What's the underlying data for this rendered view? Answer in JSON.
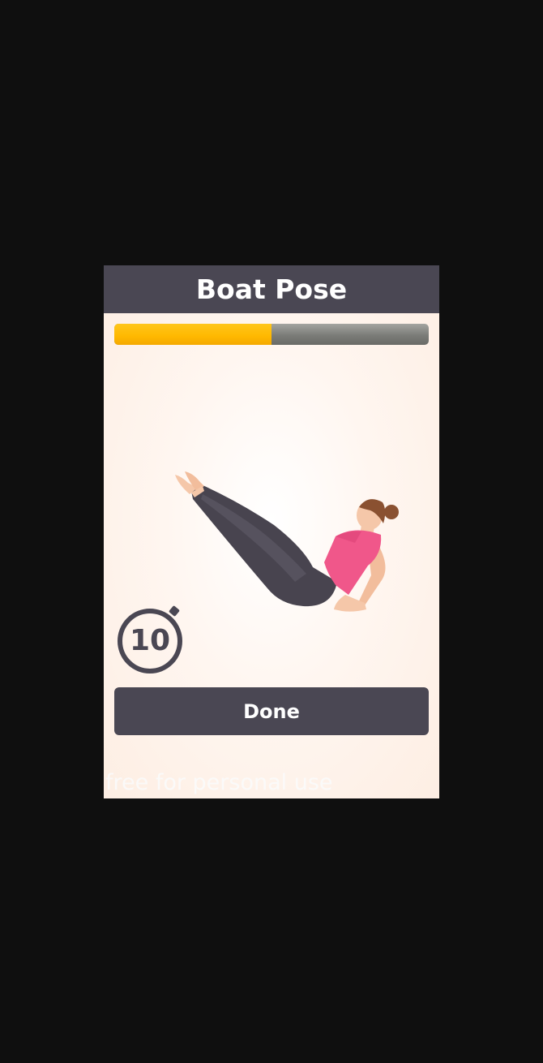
{
  "screen": {
    "title": "Boat Pose",
    "progress_fraction": 0.5,
    "illustration": "boat-pose-figure",
    "timer": {
      "icon": "stopwatch-icon",
      "value": "10"
    },
    "done_button": {
      "label": "Done"
    },
    "watermark": "free for personal use"
  },
  "colors": {
    "header_bg": "#4a4753",
    "progress_fill": "#ffb800",
    "progress_track": "#7b7c78",
    "button_bg": "#4a4753",
    "shirt": "#f0578a",
    "pants": "#48444f"
  }
}
